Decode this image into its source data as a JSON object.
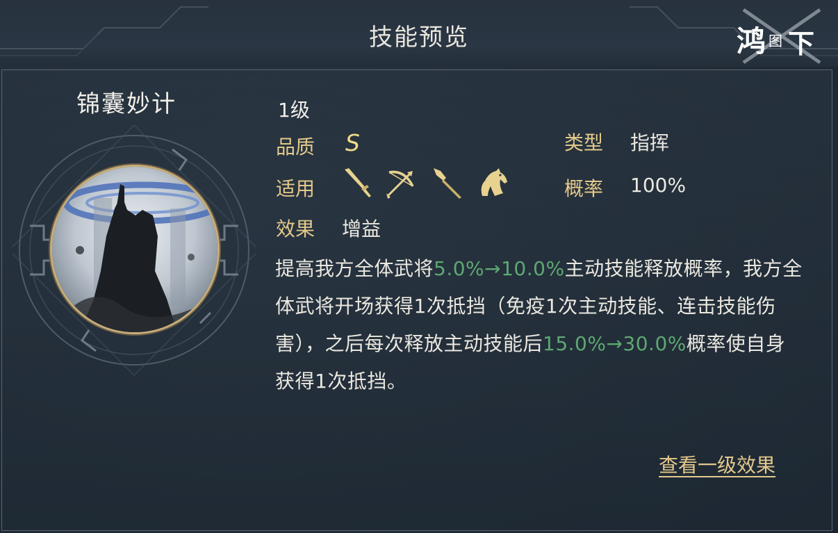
{
  "header": {
    "title": "技能预览"
  },
  "logo": {
    "text": "鸿图之下"
  },
  "skill": {
    "name": "锦囊妙计",
    "level": "1级",
    "quality_label": "品质",
    "quality_value": "S",
    "type_label": "类型",
    "type_value": "指挥",
    "apply_label": "适用",
    "apply_icons": [
      "sword-icon",
      "bow-icon",
      "spear-icon",
      "horse-icon"
    ],
    "prob_label": "概率",
    "prob_value": "100%",
    "effect_label": "效果",
    "effect_value": "增益"
  },
  "description": {
    "p1": "提高我方全体武将",
    "g1": "5.0%→10.0%",
    "p2": "主动技能释放概率，我方全体武将开场获得1次抵挡（免疫1次主动技能、连击技能伤害），之后每次释放主动技能后",
    "g2": "15.0%→30.0%",
    "p3": "概率使自身获得1次抵挡。"
  },
  "actions": {
    "view_level1": "查看一级效果"
  },
  "colors": {
    "label_gold": "#e4c98a",
    "highlight_green": "#5ea872",
    "text": "#ebe8e0",
    "background": "#222d38"
  }
}
